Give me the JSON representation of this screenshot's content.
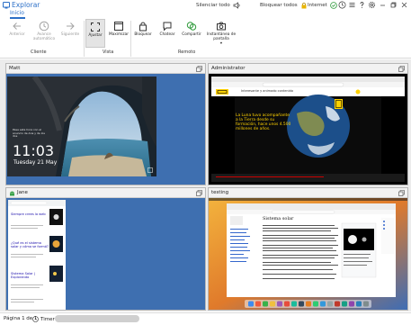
{
  "app": {
    "title": "Explorar",
    "tab": "Inicio"
  },
  "titlebar": {
    "mute_all": "Silenciar todo",
    "lock_all": "Bloquear todos",
    "internet": "Internet"
  },
  "ribbon": {
    "buttons": [
      {
        "label": "Anterior",
        "icon": "back-arrow-icon",
        "enabled": false
      },
      {
        "label": "Avance automático",
        "icon": "clock-icon",
        "enabled": false
      },
      {
        "label": "Siguiente",
        "icon": "forward-arrow-icon",
        "enabled": false
      },
      {
        "label": "Ajustar",
        "icon": "fit-icon",
        "enabled": true,
        "active": true
      },
      {
        "label": "Maximizar",
        "icon": "maximize-icon",
        "enabled": true
      },
      {
        "label": "Bloquear",
        "icon": "lock-icon",
        "enabled": true
      },
      {
        "label": "Chatear",
        "icon": "chat-icon",
        "enabled": true
      },
      {
        "label": "Compartir",
        "icon": "share-icon",
        "enabled": true
      },
      {
        "label": "Instantánea de pantalla",
        "icon": "camera-icon",
        "enabled": true
      }
    ],
    "groups": {
      "client": "Cliente",
      "view": "Vista",
      "remote": "Remoto"
    }
  },
  "panes": [
    {
      "name": "Matt",
      "screen": "lock-screen",
      "time": "11:03",
      "date": "Tuesday 21 May",
      "caption": "Pase esta hora con el anuncio de Ana y de los dos"
    },
    {
      "name": "Administrator",
      "screen": "video-page",
      "video_text": "La Luna tuvo acompañante a la Tierra desde su formación, hace unos 4.500 millones de años.",
      "page_text": "Interesante y animado contenido"
    },
    {
      "name": "Jane",
      "screen": "mobile-browser",
      "items": [
        "Siempre crees la web",
        "¿Qué es el sistema solar y cómo se formó?",
        "Sistema Solar | Explorando"
      ]
    },
    {
      "name": "testing",
      "screen": "wiki-browser",
      "heading": "Sistema solar"
    }
  ],
  "status": {
    "page": "Página 1 de 1",
    "timer": "Timer"
  },
  "colors": {
    "accent": "#2b6fc7",
    "pane_bg": "#3e6fb0",
    "ok_green": "#2e9a3a"
  }
}
